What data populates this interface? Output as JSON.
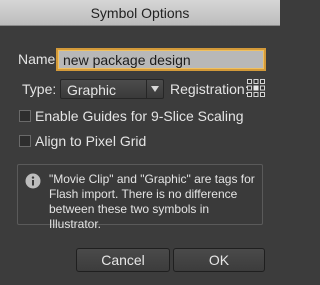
{
  "window": {
    "title": "Symbol Options"
  },
  "form": {
    "name_label": "Name:",
    "name_value": "new package design",
    "type_label": "Type:",
    "type_selected": "Graphic",
    "registration_label": "Registration:",
    "enable_guides_label": "Enable Guides for 9-Slice Scaling",
    "enable_guides_checked": false,
    "align_pixel_label": "Align to Pixel Grid",
    "align_pixel_checked": false
  },
  "info": {
    "icon": "info-icon",
    "line1": "\"Movie Clip\" and \"Graphic\" are tags for",
    "line2": "Flash import. There is no difference",
    "line3": "between these two symbols in Illustrator."
  },
  "buttons": {
    "cancel": "Cancel",
    "ok": "OK"
  },
  "colors": {
    "background": "#3c3c3c",
    "focus_ring": "#d39a3a"
  }
}
